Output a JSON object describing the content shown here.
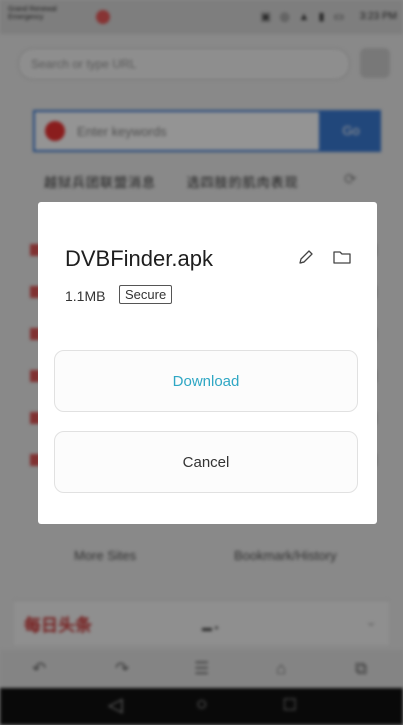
{
  "status_bar": {
    "carrier": "Grand Renewal\nEmergency",
    "time": "3:23 PM"
  },
  "browser": {
    "url_placeholder": "Search or type URL",
    "search_placeholder": "Enter keywords",
    "go_label": "Go",
    "hot_searches": [
      "越狱兵团联盟消息",
      "选四肢的肌肉表现"
    ],
    "bottom_links": [
      "More Sites",
      "Bookmark/History"
    ],
    "news_title": "每日头条"
  },
  "dialog": {
    "file_name": "DVBFinder.apk",
    "file_size": "1.1MB",
    "badge": "Secure",
    "download_label": "Download",
    "cancel_label": "Cancel",
    "accent_color": "#2fa7c4"
  }
}
